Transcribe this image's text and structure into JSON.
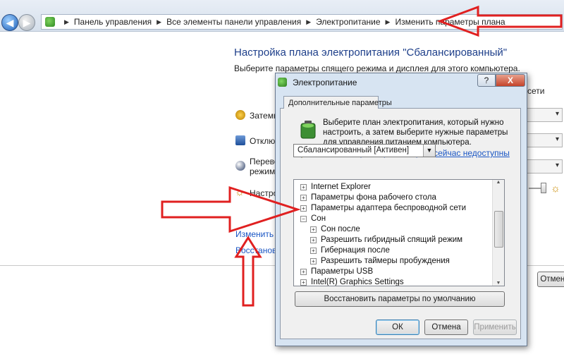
{
  "breadcrumb": [
    "Панель управления",
    "Все элементы панели управления",
    "Электропитание",
    "Изменить параметры плана"
  ],
  "page": {
    "title": "Настройка плана электропитания \"Сбалансированный\"",
    "subtitle": "Выберите параметры спящего режима и дисплея для этого компьютера.",
    "rows": [
      {
        "label": "Затемн",
        "icon": "dim-display-icon"
      },
      {
        "label": "Отключ",
        "icon": "display-off-icon"
      },
      {
        "label": "Перевод",
        "label2": "режим:",
        "icon": "sleep-icon"
      },
      {
        "label": "Настрой",
        "icon": "brightness-icon"
      }
    ],
    "link_change": "Изменить до",
    "link_restore": "Восстановит",
    "right_fragment": "сети",
    "right_button": "Отмена"
  },
  "dialog": {
    "title": "Электропитание",
    "tab": "Дополнительные параметры",
    "description": "Выберите план электропитания, который нужно настроить, а затем выберите нужные параметры для управления питанием компьютера.",
    "link": "Изменить параметры, которые сейчас недоступны",
    "plan_selected": "Сбалансированный [Активен]",
    "tree": [
      {
        "label": "Internet Explorer",
        "level": 0,
        "sign": "+"
      },
      {
        "label": "Параметры фона рабочего стола",
        "level": 0,
        "sign": "+"
      },
      {
        "label": "Параметры адаптера беспроводной сети",
        "level": 0,
        "sign": "+"
      },
      {
        "label": "Сон",
        "level": 0,
        "sign": "−"
      },
      {
        "label": "Сон после",
        "level": 1,
        "sign": "+"
      },
      {
        "label": "Разрешить гибридный спящий режим",
        "level": 1,
        "sign": "+"
      },
      {
        "label": "Гибернация после",
        "level": 1,
        "sign": "+"
      },
      {
        "label": "Разрешить таймеры пробуждения",
        "level": 1,
        "sign": "+"
      },
      {
        "label": "Параметры USB",
        "level": 0,
        "sign": "+"
      },
      {
        "label": "Intel(R) Graphics Settings",
        "level": 0,
        "sign": "+"
      }
    ],
    "restore_button": "Восстановить параметры по умолчанию",
    "ok": "ОК",
    "cancel": "Отмена",
    "apply": "Применить",
    "help": "?",
    "close": "X"
  },
  "colors": {
    "arrow": "#e02020",
    "title_blue": "#1e3f8a",
    "link": "#1a56c4"
  }
}
